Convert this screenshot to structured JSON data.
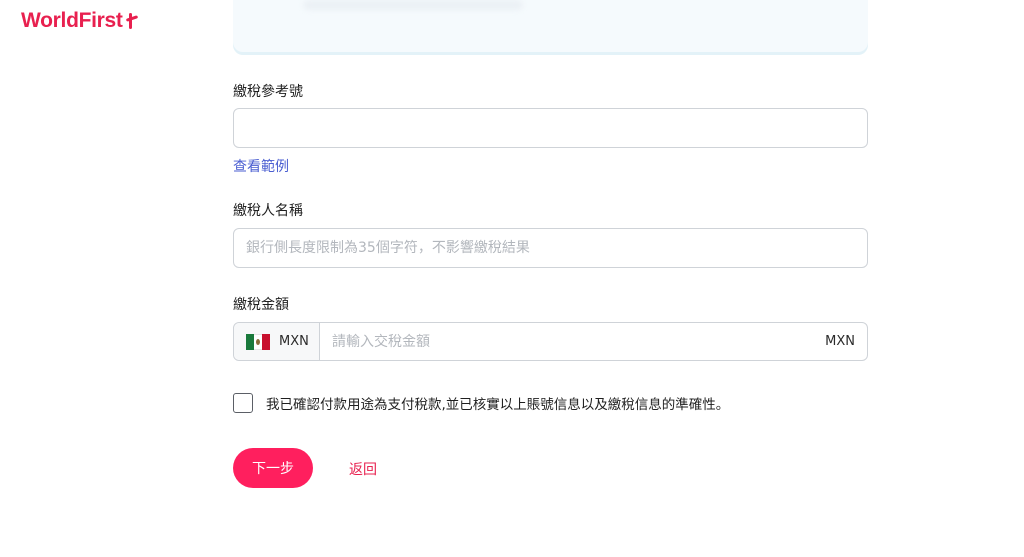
{
  "brand": {
    "name": "WorldFirst",
    "color": "#e8204f"
  },
  "form": {
    "tax_ref": {
      "label": "繳稅參考號",
      "value": "",
      "placeholder": ""
    },
    "view_example": "查看範例",
    "taxpayer_name": {
      "label": "繳稅人名稱",
      "value": "",
      "placeholder": "銀行側長度限制為35個字符，不影響繳稅結果"
    },
    "tax_amount": {
      "label": "繳稅金額",
      "currency": "MXN",
      "flag_icon": "mexico-flag-icon",
      "value": "",
      "placeholder": "請輸入交稅金額",
      "suffix": "MXN"
    },
    "confirm": {
      "checked": false,
      "text": "我已確認付款用途為支付稅款,並已核實以上賬號信息以及繳稅信息的準確性。"
    }
  },
  "actions": {
    "next_label": "下一步",
    "back_label": "返回",
    "accent": "#ff1f5e"
  }
}
